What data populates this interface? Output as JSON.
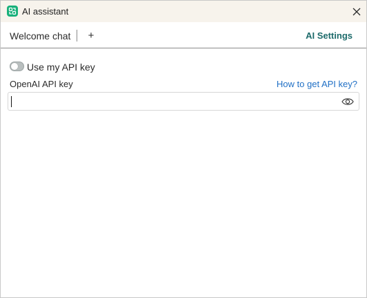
{
  "window": {
    "title": "AI assistant",
    "app_icon": "app-logo-icon",
    "close_icon": "close-icon"
  },
  "tabs": {
    "welcome_label": "Welcome chat",
    "add_label": "+",
    "settings_label": "AI Settings"
  },
  "settings": {
    "toggle_label": "Use my API key",
    "toggle_on": false,
    "field_label": "OpenAI API key",
    "help_link": "How to get API key?",
    "api_key_value": "",
    "eye_icon": "eye-icon"
  },
  "colors": {
    "accent": "#1d6b6b",
    "link": "#1f6fc5",
    "titlebar_bg": "#f7f3ec",
    "app_icon_bg": "#18b07a"
  }
}
